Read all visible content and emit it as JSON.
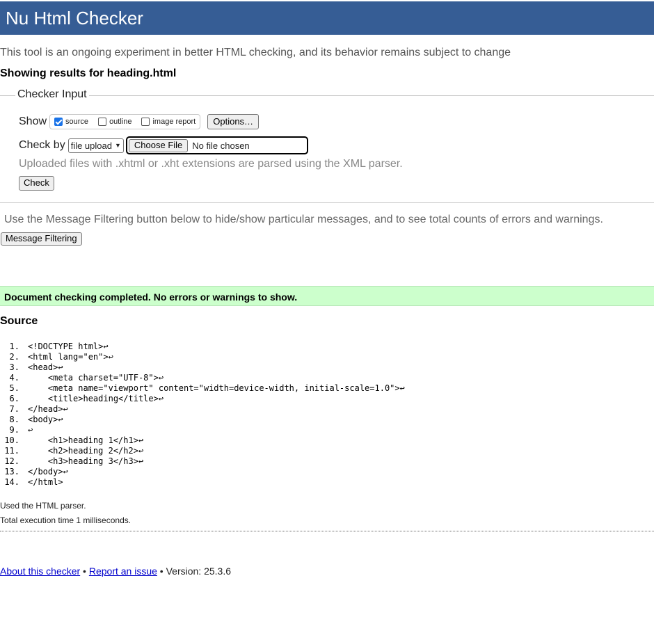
{
  "header": {
    "title": "Nu Html Checker"
  },
  "intro": "This tool is an ongoing experiment in better HTML checking, and its behavior remains subject to change",
  "showing_results": "Showing results for heading.html",
  "checker_input": {
    "legend": "Checker Input",
    "show_label": "Show",
    "show_options": [
      {
        "label": "source",
        "checked": true
      },
      {
        "label": "outline",
        "checked": false
      },
      {
        "label": "image report",
        "checked": false
      }
    ],
    "options_button": "Options…",
    "check_by_label": "Check by",
    "check_by_select": "file upload",
    "choose_file_button": "Choose File",
    "file_status": "No file chosen",
    "xml_note": "Uploaded files with .xhtml or .xht extensions are parsed using the XML parser.",
    "check_button": "Check"
  },
  "filter_note": "Use the Message Filtering button below to hide/show particular messages, and to see total counts of errors and warnings.",
  "filter_button": "Message Filtering",
  "success_message": "Document checking completed. No errors or warnings to show.",
  "source": {
    "title": "Source",
    "lines": [
      {
        "num": "1.",
        "text": "<!DOCTYPE html>↩"
      },
      {
        "num": "2.",
        "text": "<html lang=\"en\">↩"
      },
      {
        "num": "3.",
        "text": "<head>↩"
      },
      {
        "num": "4.",
        "text": "    <meta charset=\"UTF-8\">↩"
      },
      {
        "num": "5.",
        "text": "    <meta name=\"viewport\" content=\"width=device-width, initial-scale=1.0\">↩"
      },
      {
        "num": "6.",
        "text": "    <title>heading</title>↩"
      },
      {
        "num": "7.",
        "text": "</head>↩"
      },
      {
        "num": "8.",
        "text": "<body>↩"
      },
      {
        "num": "9.",
        "text": "↩"
      },
      {
        "num": "10.",
        "text": "    <h1>heading 1</h1>↩"
      },
      {
        "num": "11.",
        "text": "    <h2>heading 2</h2>↩"
      },
      {
        "num": "12.",
        "text": "    <h3>heading 3</h3>↩"
      },
      {
        "num": "13.",
        "text": "</body>↩"
      },
      {
        "num": "14.",
        "text": "</html>"
      }
    ]
  },
  "parser_note": "Used the HTML parser.",
  "execution_note": "Total execution time 1 milliseconds.",
  "footer": {
    "about_link": "About this checker",
    "separator": " • ",
    "report_link": "Report an issue",
    "version": " • Version: 25.3.6"
  },
  "colors": {
    "header_bg": "#365d95",
    "success_bg": "#ccffcc",
    "link": "#0000cc"
  }
}
